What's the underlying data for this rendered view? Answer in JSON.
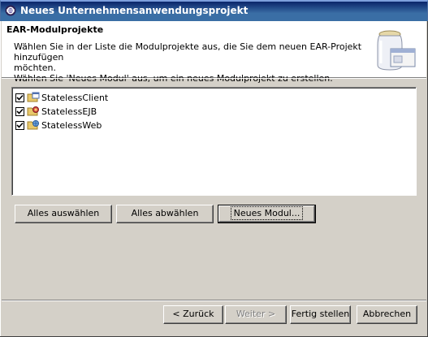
{
  "window": {
    "title": "Neues Unternehmensanwendungsprojekt"
  },
  "header": {
    "title": "EAR-Modulprojekte",
    "description_line1": "Wählen Sie in der Liste die Modulprojekte aus, die Sie dem neuen EAR-Projekt hinzufügen",
    "description_line2": "möchten.",
    "description_line3": "Wählen Sie 'Neues Modul' aus, um ein neues Modulprojekt zu erstellen."
  },
  "modules": [
    {
      "label": "StatelessClient",
      "checked": true,
      "icon": "application-client-project-icon"
    },
    {
      "label": "StatelessEJB",
      "checked": true,
      "icon": "ejb-project-icon"
    },
    {
      "label": "StatelessWeb",
      "checked": true,
      "icon": "web-project-icon"
    }
  ],
  "actions": {
    "select_all": "Alles auswählen",
    "deselect_all": "Alles abwählen",
    "new_module": "Neues Modul..."
  },
  "footer": {
    "back": "< Zurück",
    "next": "Weiter >",
    "finish": "Fertig stellen",
    "cancel": "Abbrechen"
  },
  "colors": {
    "titlebar": "#0a246a",
    "dialog_bg": "#d4d0c8",
    "header_bg": "#ffffff"
  }
}
